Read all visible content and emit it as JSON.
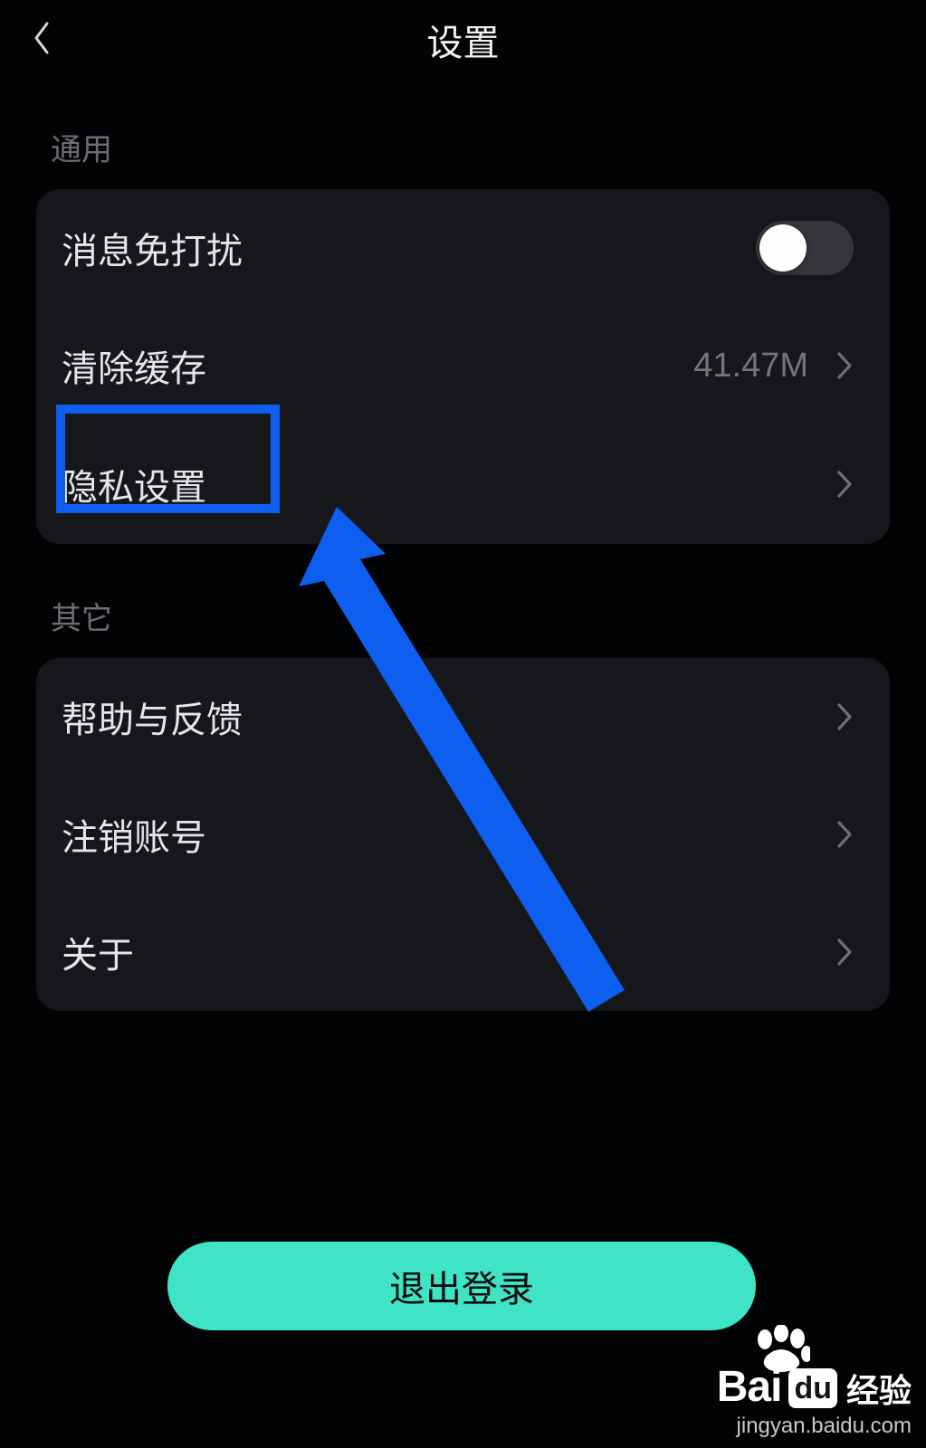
{
  "header": {
    "title": "设置"
  },
  "sections": {
    "general": {
      "label": "通用",
      "items": {
        "dnd": {
          "label": "消息免打扰",
          "toggle_on": false
        },
        "cache": {
          "label": "清除缓存",
          "value": "41.47M"
        },
        "privacy": {
          "label": "隐私设置"
        }
      }
    },
    "other": {
      "label": "其它",
      "items": {
        "help": {
          "label": "帮助与反馈"
        },
        "deactivate": {
          "label": "注销账号"
        },
        "about": {
          "label": "关于"
        }
      }
    }
  },
  "logout": {
    "label": "退出登录"
  },
  "watermark": {
    "brand_left": "Bai",
    "brand_box": "du",
    "brand_right": "经验",
    "url": "jingyan.baidu.com"
  },
  "annotation": {
    "highlight_target": "privacy",
    "arrow_color": "#0e5ef0"
  }
}
